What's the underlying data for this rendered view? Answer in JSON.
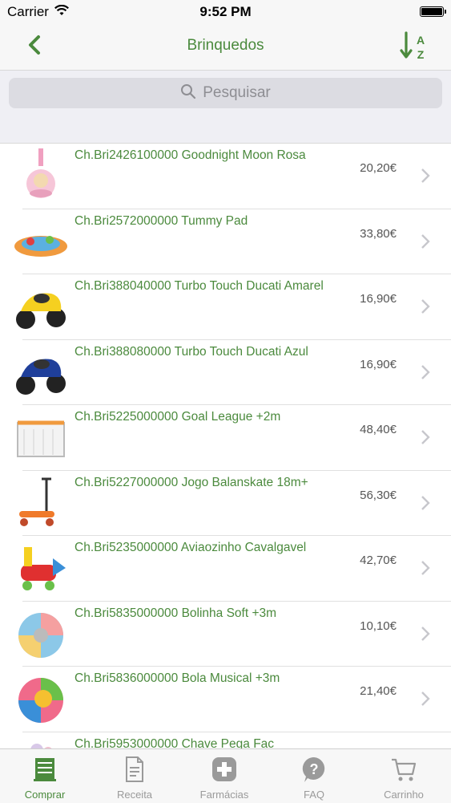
{
  "status_bar": {
    "carrier": "Carrier",
    "time": "9:52 PM"
  },
  "nav": {
    "title": "Brinquedos",
    "sort_top": "A",
    "sort_bottom": "Z"
  },
  "search": {
    "placeholder": "Pesquisar"
  },
  "products": [
    {
      "name": "Ch.Bri2426100000 Goodnight Moon Rosa",
      "price": "20,20€",
      "icon": "pink-night-light-toy"
    },
    {
      "name": "Ch.Bri2572000000 Tummy Pad",
      "price": "33,80€",
      "icon": "play-mat-toy"
    },
    {
      "name": "Ch.Bri388040000 Turbo Touch Ducati Amarel",
      "price": "16,90€",
      "icon": "yellow-motorbike-toy"
    },
    {
      "name": "Ch.Bri388080000 Turbo Touch Ducati Azul",
      "price": "16,90€",
      "icon": "blue-motorbike-toy"
    },
    {
      "name": "Ch.Bri5225000000 Goal League +2m",
      "price": "48,40€",
      "icon": "goal-toy"
    },
    {
      "name": "Ch.Bri5227000000 Jogo Balanskate 18m+",
      "price": "56,30€",
      "icon": "scooter-toy"
    },
    {
      "name": "Ch.Bri5235000000 Aviaozinho Cavalgavel",
      "price": "42,70€",
      "icon": "ride-on-plane-toy"
    },
    {
      "name": "Ch.Bri5835000000 Bolinha Soft +3m",
      "price": "10,10€",
      "icon": "soft-ball-toy"
    },
    {
      "name": "Ch.Bri5836000000 Bola Musical +3m",
      "price": "21,40€",
      "icon": "musical-ball-toy"
    },
    {
      "name": "Ch.Bri5953000000 Chave Pega Fac",
      "price": "",
      "icon": "keys-toy"
    }
  ],
  "tabs": [
    {
      "label": "Comprar",
      "icon": "shop-icon",
      "active": true
    },
    {
      "label": "Receita",
      "icon": "prescription-icon",
      "active": false
    },
    {
      "label": "Farmácias",
      "icon": "pharmacy-cross-icon",
      "active": false
    },
    {
      "label": "FAQ",
      "icon": "question-icon",
      "active": false
    },
    {
      "label": "Carrinho",
      "icon": "cart-icon",
      "active": false
    }
  ],
  "colors": {
    "accent": "#4b8a3d",
    "inactive": "#9a9a9a",
    "background": "#f7f7f7"
  }
}
